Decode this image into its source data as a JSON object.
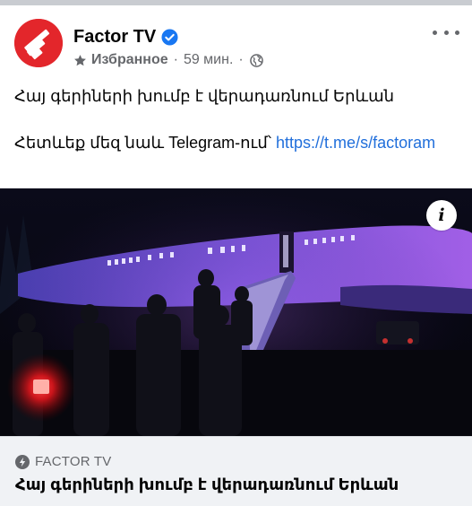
{
  "post": {
    "page_name": "Factor TV",
    "favorites_label": "Избранное",
    "time_label": "59 мин.",
    "separator": "·",
    "text_line1": "Հայ գերիների խումբ է վերադառնում Երևան",
    "text_line2_prefix": "Հետևեք մեզ նաև Telegram-ում՝ ",
    "text_link": "https://t.me/s/factoram"
  },
  "media": {
    "info_label": "i"
  },
  "link_card": {
    "source": "FACTOR TV",
    "title": "Հայ գերիների խումբ է վերադառնում Երևան"
  },
  "colors": {
    "brand_red": "#e3262b",
    "verified_blue": "#1877f2",
    "link_blue": "#216fdb",
    "secondary_text": "#65676b",
    "card_bg": "#f0f2f5"
  },
  "icons": {
    "avatar": "factor-tv-logo",
    "verified": "verified-badge-icon",
    "favorites": "star-icon",
    "audience": "globe-icon",
    "more": "more-options-icon",
    "info": "info-icon",
    "source": "bolt-icon"
  }
}
